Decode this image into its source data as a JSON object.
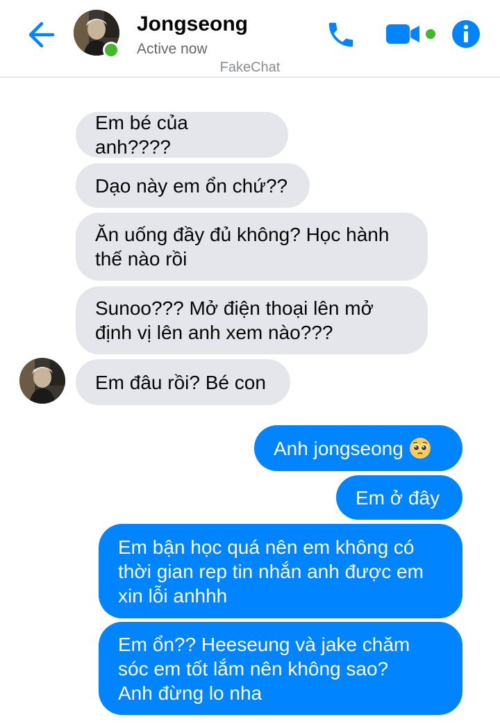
{
  "header": {
    "contact_name": "Jongseong",
    "status": "Active now",
    "watermark": "FakeChat",
    "icons": {
      "back": "arrow-left-icon",
      "call": "phone-icon",
      "video": "video-camera-icon",
      "info": "info-icon"
    },
    "accent_color": "#0084ff",
    "active_color": "#42b72a"
  },
  "messages": [
    {
      "side": "incoming",
      "text": "Em bé của anh????"
    },
    {
      "side": "incoming",
      "text": "Dạo này em ổn chứ??"
    },
    {
      "side": "incoming",
      "text": "Ăn uống đầy đủ không? Học hành\nthế nào rồi"
    },
    {
      "side": "incoming",
      "text": "Sunoo??? Mở điện thoại lên mở\nđịnh vị lên anh xem nào???"
    },
    {
      "side": "incoming",
      "text": "Em đâu rồi? Bé con"
    },
    {
      "side": "outgoing",
      "text": "Anh jongseong",
      "emoji": "pleading-face-icon"
    },
    {
      "side": "outgoing",
      "text": "Em ở đây"
    },
    {
      "side": "outgoing",
      "text": "Em bận học quá nên em không có\nthời gian rep tin nhắn anh được em\nxin lỗi anhhh"
    },
    {
      "side": "outgoing",
      "text": "Em ổn?? Heeseung và jake chăm\nsóc em tốt lắm nên không sao?\nAnh đừng lo nha"
    }
  ],
  "colors": {
    "incoming_bubble": "#e4e6eb",
    "outgoing_bubble": "#0084ff"
  }
}
